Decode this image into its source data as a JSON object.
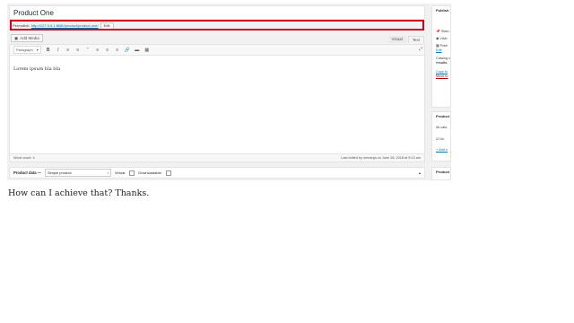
{
  "editor": {
    "post_title": "Product One",
    "permalink_label": "Permalink:",
    "permalink_url": "http://127.0.0.1:8080/product/product-one/",
    "permalink_edit": "Edit",
    "add_media": "Add Media",
    "tab_visual": "Visual",
    "tab_text": "Text",
    "format_select": "Paragraph",
    "toolbar_bold": "B",
    "toolbar_italic": "I",
    "content": "Lorem ipsum bla bla",
    "word_count": "Word count: 4",
    "last_edited": "Last edited by nemanja on June 26, 2018 at 9:13 am"
  },
  "product_data": {
    "title": "Product data —",
    "type_value": "Simple product",
    "virtual_label": "Virtual:",
    "downloadable_label": "Downloadable:"
  },
  "sidebar": {
    "publish_title": "Publish",
    "status_text": "Statu",
    "visibility_text": "Visib",
    "published_text": "Publi",
    "edit_link": "Edit",
    "catalog_line1": "Catalog v",
    "catalog_line2": "results",
    "copy_link": "Copy to",
    "move_link": "Move to",
    "categories_title": "Product",
    "all_categories": "All cate",
    "uncategorized": "Un",
    "add_new": "+ Add n",
    "tags_title": "Product"
  },
  "question": "How can I achieve that? Thanks.",
  "colors": {
    "highlight": "#d0021b",
    "link": "#0073aa",
    "background": "#f1f1f1"
  }
}
